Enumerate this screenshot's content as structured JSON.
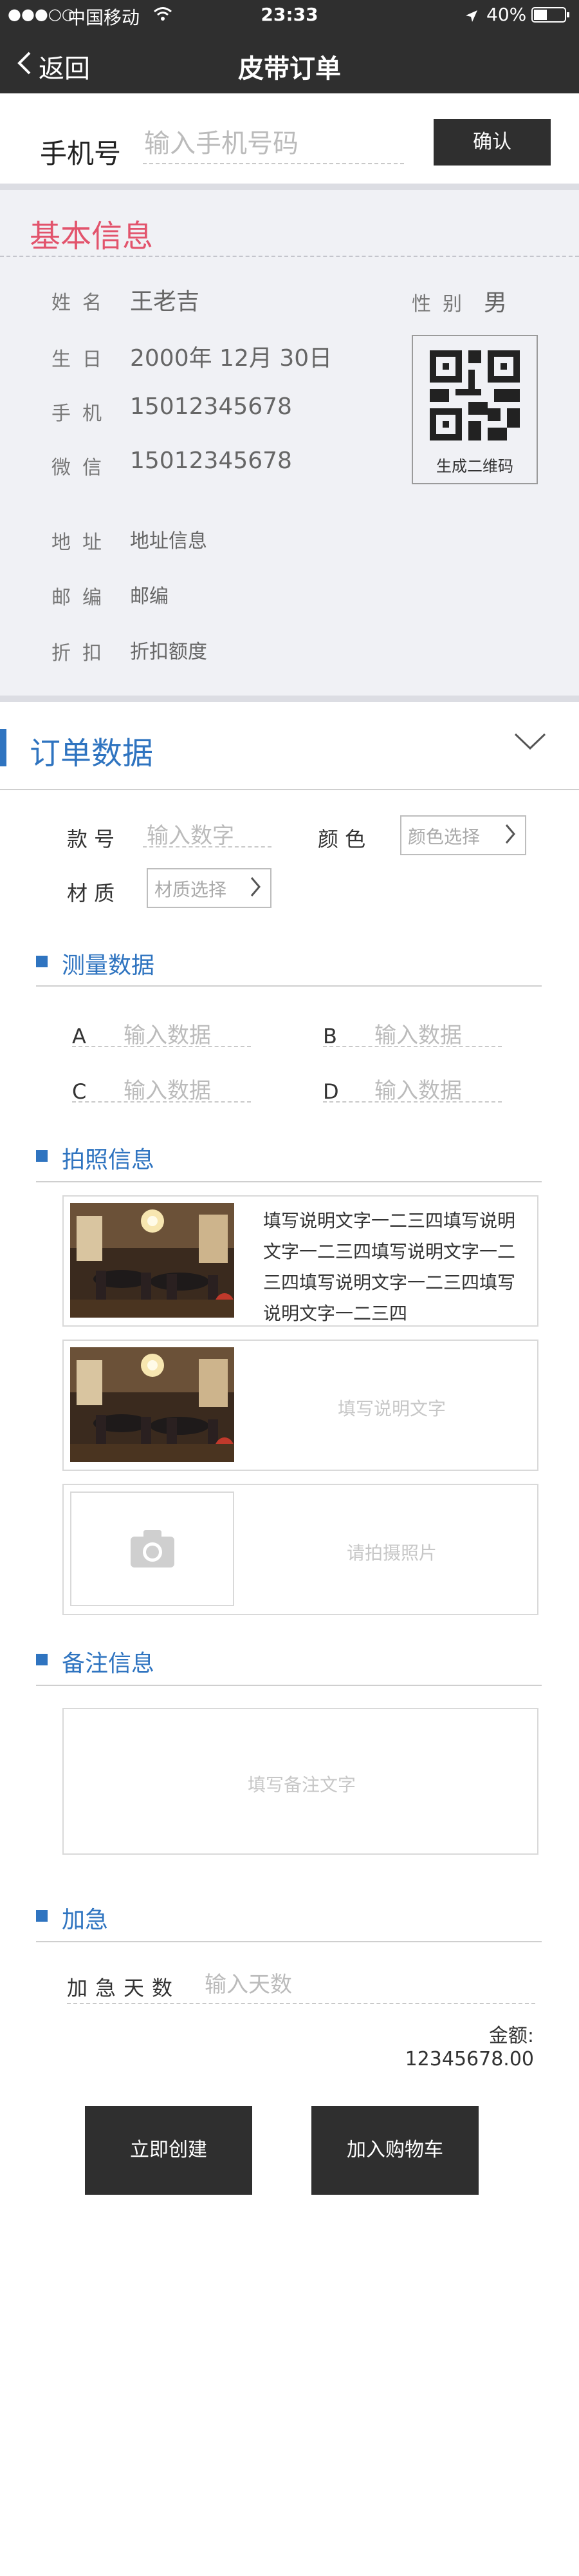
{
  "status_bar": {
    "signal_dots": "●●●○○",
    "carrier": "中国移动",
    "time": "23:33",
    "battery": "40%"
  },
  "nav": {
    "back_label": "返回",
    "title": "皮带订单"
  },
  "phone": {
    "label": "手机号",
    "placeholder": "输入手机号码",
    "confirm_label": "确认"
  },
  "basic_info": {
    "title": "基本信息",
    "name_label": "姓名",
    "name_value": "王老吉",
    "gender_label": "性别",
    "gender_value": "男",
    "birthday_label": "生日",
    "birthday_value": "2000年 12月 30日",
    "mobile_label": "手机",
    "mobile_value": "15012345678",
    "wechat_label": "微信",
    "wechat_value": "15012345678",
    "address_label": "地址",
    "address_value": "地址信息",
    "postcode_label": "邮编",
    "postcode_value": "邮编",
    "discount_label": "折扣",
    "discount_value": "折扣额度",
    "qr_caption": "生成二维码",
    "title_color": "#e2536c"
  },
  "order": {
    "title": "订单数据",
    "accent_color": "#2f74c0",
    "style_label": "款  号",
    "style_placeholder": "输入数字",
    "color_label": "颜  色",
    "color_select": "颜色选择",
    "material_label": "材  质",
    "material_select": "材质选择"
  },
  "measurement": {
    "title": "测量数据",
    "fields": [
      {
        "key": "A",
        "placeholder": "输入数据"
      },
      {
        "key": "B",
        "placeholder": "输入数据"
      },
      {
        "key": "C",
        "placeholder": "输入数据"
      },
      {
        "key": "D",
        "placeholder": "输入数据"
      }
    ]
  },
  "photos": {
    "title": "拍照信息",
    "items": [
      {
        "text": "填写说明文字一二三四填写说明文字一二三四填写说明文字一二三四填写说明文字一二三四填写说明文字一二三四"
      },
      {
        "placeholder": "填写说明文字"
      },
      {
        "placeholder": "请拍摄照片"
      }
    ]
  },
  "remark": {
    "title": "备注信息",
    "placeholder": "填写备注文字"
  },
  "urgent": {
    "title": "加急",
    "days_label": "加急天数",
    "days_placeholder": "输入天数",
    "amount_label": "金额:",
    "amount_value": "12345678.00"
  },
  "actions": {
    "create_label": "立即创建",
    "cart_label": "加入购物车"
  }
}
